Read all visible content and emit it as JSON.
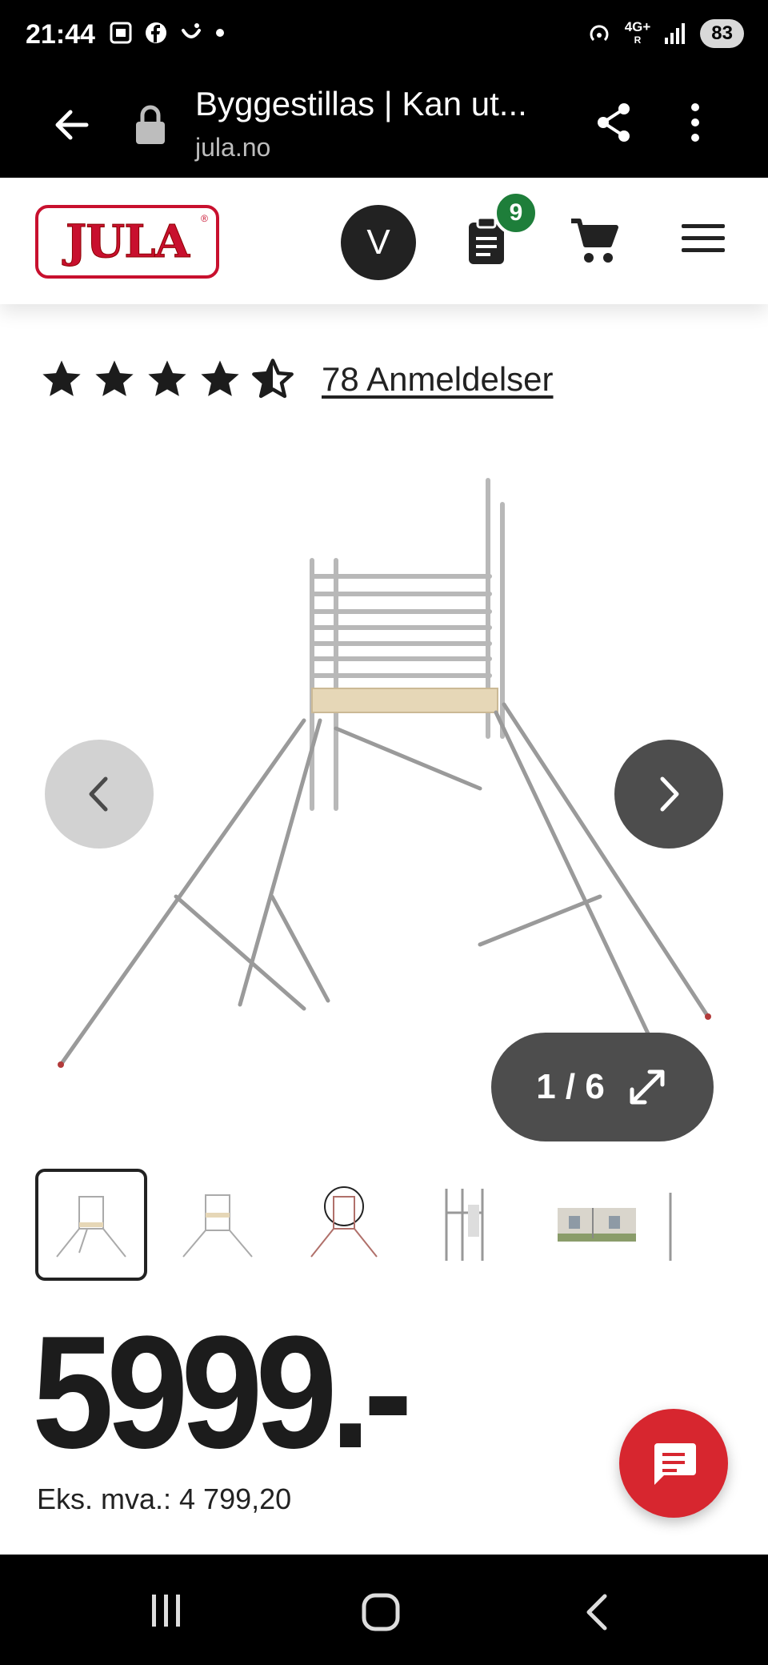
{
  "status_bar": {
    "time": "21:44",
    "network": "4G+",
    "network_sub": "R",
    "battery": "83"
  },
  "browser": {
    "title": "Byggestillas | Kan ut...",
    "url": "jula.no"
  },
  "header": {
    "logo_text": "JULA",
    "avatar_initial": "V",
    "lists_badge_count": "9"
  },
  "product": {
    "rating": 4.5,
    "reviews_label": "78 Anmeldelser",
    "gallery_counter": "1 / 6",
    "price": "5999.-",
    "ex_vat": "Eks. mva.: 4 799,20"
  },
  "icons": [
    "back-arrow-icon",
    "lock-icon",
    "share-icon",
    "more-vertical-icon",
    "clipboard-list-icon",
    "cart-icon",
    "hamburger-menu-icon",
    "star-icon",
    "half-star-icon",
    "chevron-left-icon",
    "chevron-right-icon",
    "expand-icon",
    "chat-icon",
    "recents-icon",
    "home-icon",
    "back-icon"
  ],
  "colors": {
    "brand_red": "#c8102e",
    "badge_green": "#1e7e3a",
    "chat_red": "#d7262f",
    "dark_button": "#4d4d4d"
  }
}
